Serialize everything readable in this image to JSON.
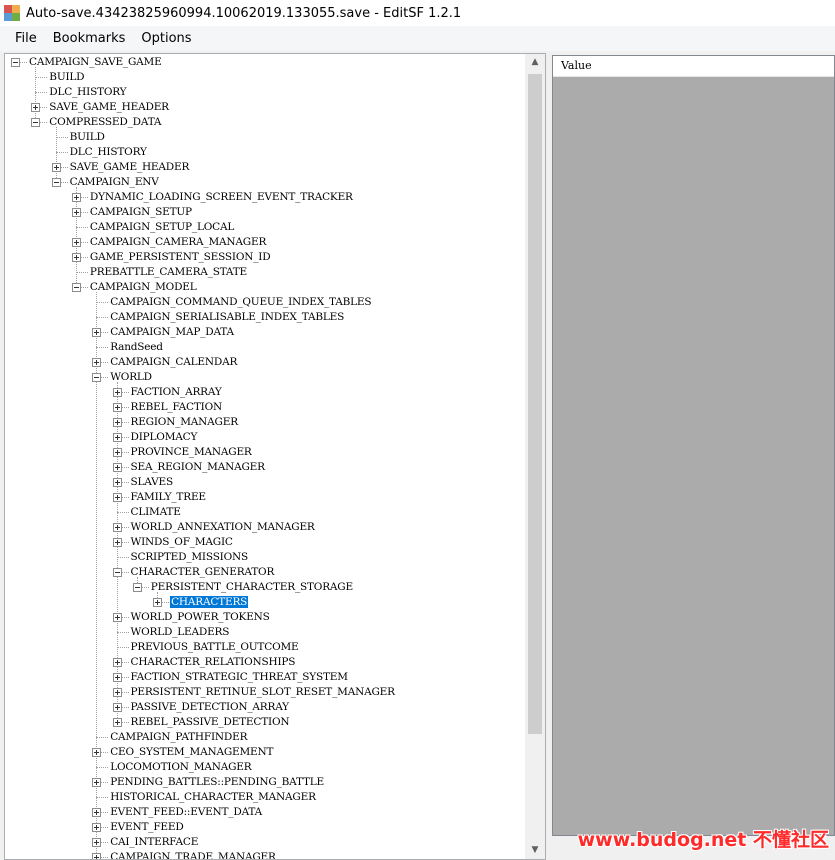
{
  "window": {
    "title": "Auto-save.43423825960994.10062019.133055.save - EditSF 1.2.1"
  },
  "menu": [
    "File",
    "Bookmarks",
    "Options"
  ],
  "tree": [
    {
      "label": "CAMPAIGN_SAVE_GAME",
      "depth": 0,
      "state": "expanded"
    },
    {
      "label": "BUILD",
      "depth": 1,
      "state": "leaf"
    },
    {
      "label": "DLC_HISTORY",
      "depth": 1,
      "state": "leaf"
    },
    {
      "label": "SAVE_GAME_HEADER",
      "depth": 1,
      "state": "collapsed"
    },
    {
      "label": "COMPRESSED_DATA",
      "depth": 1,
      "state": "expanded"
    },
    {
      "label": "BUILD",
      "depth": 2,
      "state": "leaf"
    },
    {
      "label": "DLC_HISTORY",
      "depth": 2,
      "state": "leaf"
    },
    {
      "label": "SAVE_GAME_HEADER",
      "depth": 2,
      "state": "collapsed"
    },
    {
      "label": "CAMPAIGN_ENV",
      "depth": 2,
      "state": "expanded"
    },
    {
      "label": "DYNAMIC_LOADING_SCREEN_EVENT_TRACKER",
      "depth": 3,
      "state": "collapsed"
    },
    {
      "label": "CAMPAIGN_SETUP",
      "depth": 3,
      "state": "collapsed"
    },
    {
      "label": "CAMPAIGN_SETUP_LOCAL",
      "depth": 3,
      "state": "leaf"
    },
    {
      "label": "CAMPAIGN_CAMERA_MANAGER",
      "depth": 3,
      "state": "collapsed"
    },
    {
      "label": "GAME_PERSISTENT_SESSION_ID",
      "depth": 3,
      "state": "collapsed"
    },
    {
      "label": "PREBATTLE_CAMERA_STATE",
      "depth": 3,
      "state": "leaf"
    },
    {
      "label": "CAMPAIGN_MODEL",
      "depth": 3,
      "state": "expanded"
    },
    {
      "label": "CAMPAIGN_COMMAND_QUEUE_INDEX_TABLES",
      "depth": 4,
      "state": "leaf"
    },
    {
      "label": "CAMPAIGN_SERIALISABLE_INDEX_TABLES",
      "depth": 4,
      "state": "leaf"
    },
    {
      "label": "CAMPAIGN_MAP_DATA",
      "depth": 4,
      "state": "collapsed"
    },
    {
      "label": "RandSeed",
      "depth": 4,
      "state": "leaf"
    },
    {
      "label": "CAMPAIGN_CALENDAR",
      "depth": 4,
      "state": "collapsed"
    },
    {
      "label": "WORLD",
      "depth": 4,
      "state": "expanded"
    },
    {
      "label": "FACTION_ARRAY",
      "depth": 5,
      "state": "collapsed"
    },
    {
      "label": "REBEL_FACTION",
      "depth": 5,
      "state": "collapsed"
    },
    {
      "label": "REGION_MANAGER",
      "depth": 5,
      "state": "collapsed"
    },
    {
      "label": "DIPLOMACY",
      "depth": 5,
      "state": "collapsed"
    },
    {
      "label": "PROVINCE_MANAGER",
      "depth": 5,
      "state": "collapsed"
    },
    {
      "label": "SEA_REGION_MANAGER",
      "depth": 5,
      "state": "collapsed"
    },
    {
      "label": "SLAVES",
      "depth": 5,
      "state": "collapsed"
    },
    {
      "label": "FAMILY_TREE",
      "depth": 5,
      "state": "collapsed"
    },
    {
      "label": "CLIMATE",
      "depth": 5,
      "state": "leaf"
    },
    {
      "label": "WORLD_ANNEXATION_MANAGER",
      "depth": 5,
      "state": "collapsed"
    },
    {
      "label": "WINDS_OF_MAGIC",
      "depth": 5,
      "state": "collapsed"
    },
    {
      "label": "SCRIPTED_MISSIONS",
      "depth": 5,
      "state": "leaf"
    },
    {
      "label": "CHARACTER_GENERATOR",
      "depth": 5,
      "state": "expanded"
    },
    {
      "label": "PERSISTENT_CHARACTER_STORAGE",
      "depth": 6,
      "state": "expanded"
    },
    {
      "label": "CHARACTERS",
      "depth": 7,
      "state": "collapsed",
      "selected": true
    },
    {
      "label": "WORLD_POWER_TOKENS",
      "depth": 5,
      "state": "collapsed"
    },
    {
      "label": "WORLD_LEADERS",
      "depth": 5,
      "state": "leaf"
    },
    {
      "label": "PREVIOUS_BATTLE_OUTCOME",
      "depth": 5,
      "state": "leaf"
    },
    {
      "label": "CHARACTER_RELATIONSHIPS",
      "depth": 5,
      "state": "collapsed"
    },
    {
      "label": "FACTION_STRATEGIC_THREAT_SYSTEM",
      "depth": 5,
      "state": "collapsed"
    },
    {
      "label": "PERSISTENT_RETINUE_SLOT_RESET_MANAGER",
      "depth": 5,
      "state": "collapsed"
    },
    {
      "label": "PASSIVE_DETECTION_ARRAY",
      "depth": 5,
      "state": "collapsed"
    },
    {
      "label": "REBEL_PASSIVE_DETECTION",
      "depth": 5,
      "state": "collapsed"
    },
    {
      "label": "CAMPAIGN_PATHFINDER",
      "depth": 4,
      "state": "leaf"
    },
    {
      "label": "CEO_SYSTEM_MANAGEMENT",
      "depth": 4,
      "state": "collapsed"
    },
    {
      "label": "LOCOMOTION_MANAGER",
      "depth": 4,
      "state": "leaf"
    },
    {
      "label": "PENDING_BATTLES::PENDING_BATTLE",
      "depth": 4,
      "state": "collapsed"
    },
    {
      "label": "HISTORICAL_CHARACTER_MANAGER",
      "depth": 4,
      "state": "leaf"
    },
    {
      "label": "EVENT_FEED::EVENT_DATA",
      "depth": 4,
      "state": "collapsed"
    },
    {
      "label": "EVENT_FEED",
      "depth": 4,
      "state": "collapsed"
    },
    {
      "label": "CAI_INTERFACE",
      "depth": 4,
      "state": "collapsed"
    },
    {
      "label": "CAMPAIGN_TRADE_MANAGER",
      "depth": 4,
      "state": "collapsed"
    }
  ],
  "value_panel": {
    "header": "Value"
  },
  "watermark": "www.budog.net 不懂社区",
  "colors": {
    "selection": "#0078d7",
    "value_area": "#ababab",
    "watermark": "#ff2b2b"
  }
}
